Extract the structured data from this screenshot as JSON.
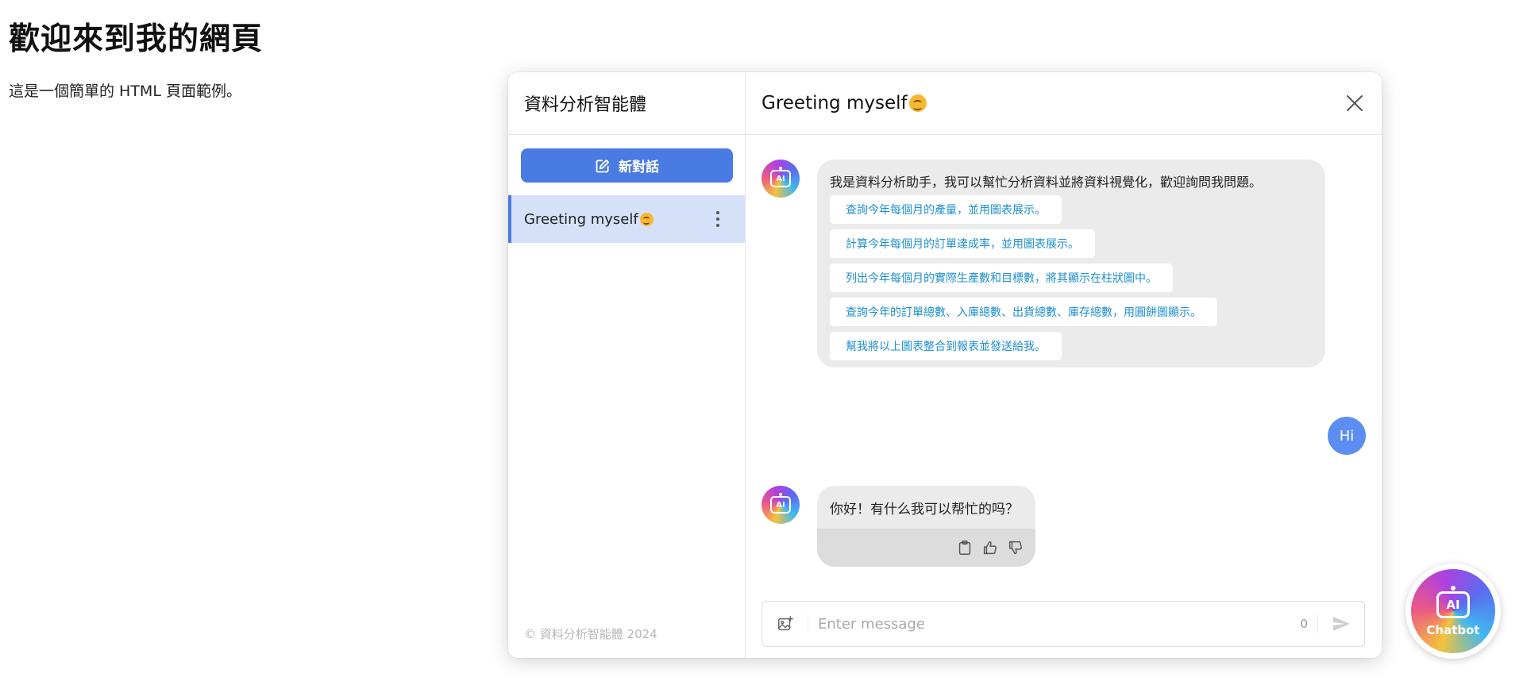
{
  "page": {
    "heading": "歡迎來到我的網頁",
    "description": "這是一個簡單的 HTML 頁面範例。"
  },
  "sidebar": {
    "title": "資料分析智能體",
    "new_chat_label": "新對話",
    "conversations": [
      {
        "title": "Greeting myself"
      }
    ],
    "footer": "© 資料分析智能體 2024"
  },
  "chat": {
    "title": "Greeting myself",
    "messages": [
      {
        "role": "assistant",
        "avatar_text": "AI",
        "text": "我是資料分析助手，我可以幫忙分析資料並將資料視覺化，歡迎詢問我問題。",
        "suggestions": [
          "查詢今年每個月的產量，並用圖表展示。",
          "計算今年每個月的訂單達成率，並用圖表展示。",
          "列出今年每個月的實際生產數和目標數，將其顯示在柱狀圖中。",
          "查詢今年的訂單總數、入庫總數、出貨總數、庫存總數，用圓餅圖顯示。",
          "幫我將以上圖表整合到報表並發送給我。"
        ]
      },
      {
        "role": "user",
        "text": "Hi"
      },
      {
        "role": "assistant",
        "avatar_text": "AI",
        "text": "你好！有什么我可以帮忙的吗？"
      }
    ],
    "input": {
      "placeholder": "Enter message",
      "char_count": "0"
    }
  },
  "fab": {
    "icon_text": "AI",
    "label": "Chatbot"
  },
  "colors": {
    "primary": "#4a7be2",
    "user_bubble": "#5b8ef0",
    "suggestion_text": "#1d8fcf",
    "active_conversation": "#d4e1f9"
  }
}
